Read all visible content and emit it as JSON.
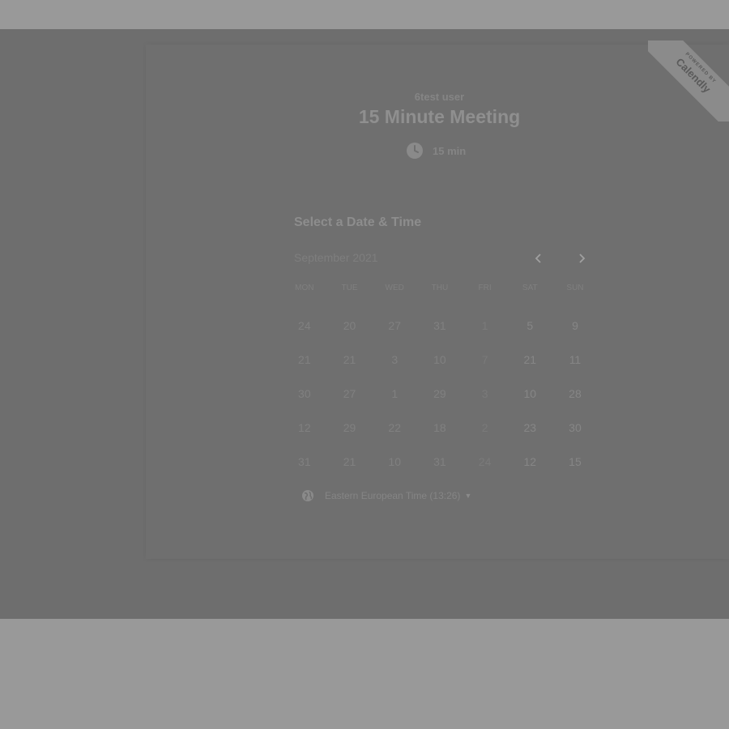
{
  "event": {
    "host": "6test user",
    "title": "15 Minute Meeting",
    "duration": "15 min"
  },
  "ribbon": {
    "small": "POWERED BY",
    "brand": "Calendly"
  },
  "scheduler": {
    "heading": "Select a Date & Time",
    "month": "September 2021",
    "prev_icon": "chevron-left-icon",
    "next_icon": "chevron-right-icon",
    "weekdays": [
      "MON",
      "TUE",
      "WED",
      "THU",
      "FRI",
      "SAT",
      "SUN"
    ],
    "weeks": [
      [
        "24",
        "20",
        "27",
        "31",
        "1",
        "5",
        "9"
      ],
      [
        "21",
        "21",
        "3",
        "10",
        "7",
        "21",
        "11"
      ],
      [
        "30",
        "27",
        "1",
        "29",
        "3",
        "10",
        "28"
      ],
      [
        "12",
        "29",
        "22",
        "18",
        "2",
        "23",
        "30"
      ],
      [
        "31",
        "21",
        "10",
        "31",
        "24",
        "12",
        "15"
      ]
    ]
  },
  "timezone": {
    "label": "Eastern European Time (13:26)",
    "icon": "globe-icon"
  },
  "colors": {
    "overlay": "#6e6e6e",
    "page_bg": "#999999"
  }
}
